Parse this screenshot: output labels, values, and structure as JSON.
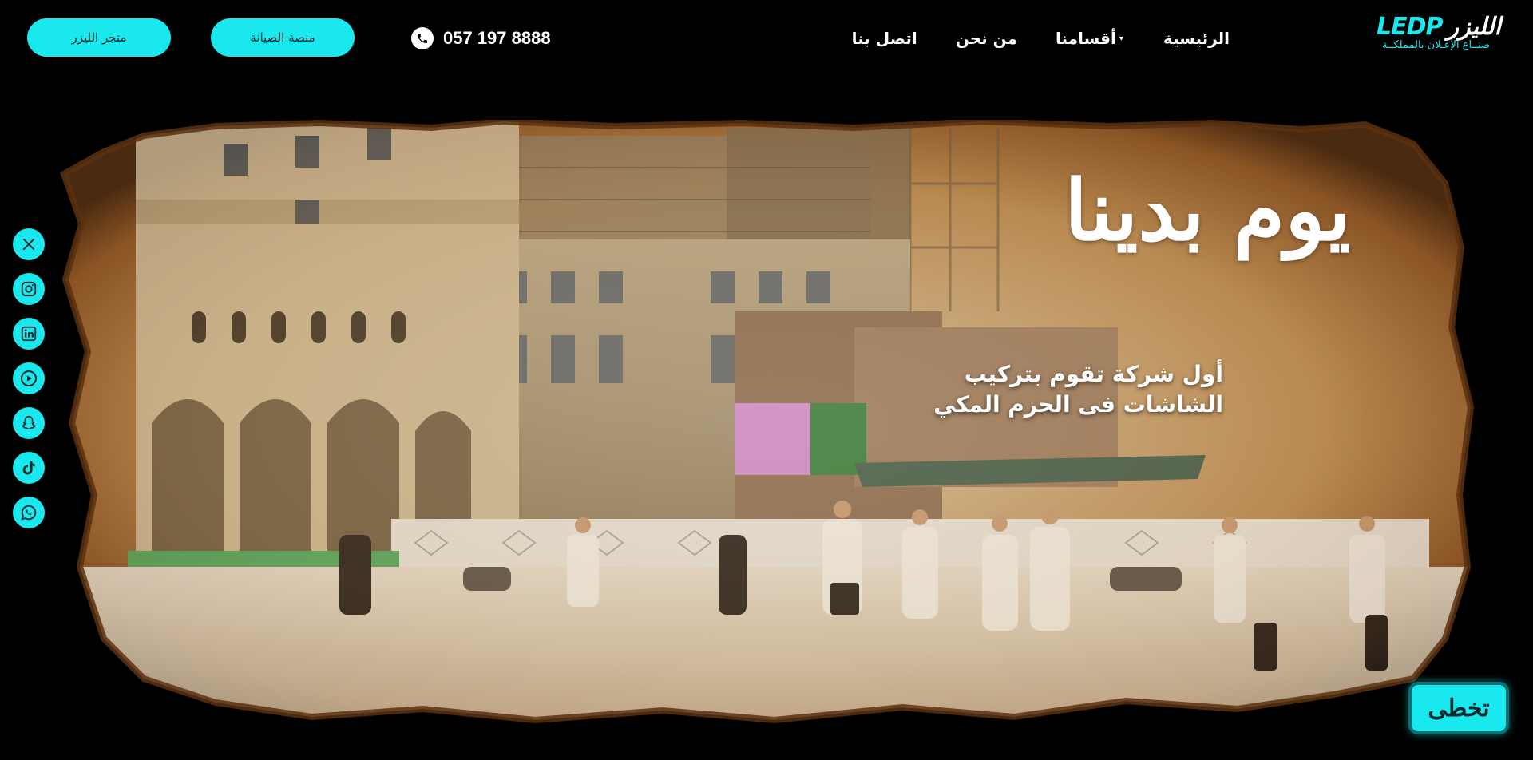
{
  "header": {
    "store_button": "متجر الليزر",
    "maintenance_button": "منصة الصيانة",
    "phone": "057 197 8888",
    "nav": [
      {
        "label": "الرئيسية"
      },
      {
        "label": "أقسامنا"
      },
      {
        "label": "من نحن"
      },
      {
        "label": "اتصل بنا"
      }
    ],
    "logo": {
      "arabic": "الليزر",
      "latin": "LEDP",
      "tagline": "صنــاع الإعـلان بالمملكــة"
    }
  },
  "social": [
    "x-icon",
    "instagram-icon",
    "linkedin-icon",
    "youtube-icon",
    "snapchat-icon",
    "tiktok-icon",
    "whatsapp-icon"
  ],
  "hero": {
    "title": "يوم بدينا",
    "subtitle_line1": "أول شركة تقوم بتركيب",
    "subtitle_line2": "الشاشات فى الحرم المكي"
  },
  "skip_button": "تخطى",
  "colors": {
    "accent": "#19e8ee",
    "background": "#000000"
  }
}
